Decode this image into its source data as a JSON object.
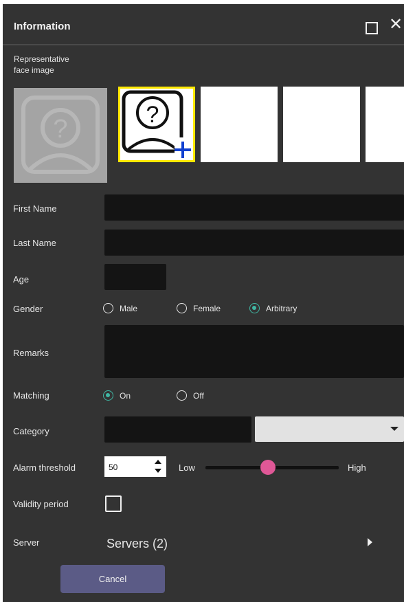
{
  "window": {
    "title": "Information"
  },
  "face": {
    "section_label_line1": "Representative",
    "section_label_line2": "face image",
    "thumbs": [
      {
        "icon": "add-face-icon",
        "selected": true
      },
      {
        "icon": "",
        "selected": false
      },
      {
        "icon": "",
        "selected": false
      },
      {
        "icon": "",
        "selected": false
      }
    ],
    "placeholder_icon": "face-placeholder-icon",
    "selected_color": "#ffe900"
  },
  "form": {
    "first_name_label": "First Name",
    "first_name_value": "",
    "last_name_label": "Last Name",
    "last_name_value": "",
    "age_label": "Age",
    "age_value": "",
    "gender_label": "Gender",
    "gender_options": [
      "Male",
      "Female",
      "Arbitrary"
    ],
    "gender_selected": "Arbitrary",
    "remarks_label": "Remarks",
    "remarks_value": "",
    "matching_label": "Matching",
    "matching_options": [
      "On",
      "Off"
    ],
    "matching_selected": "On",
    "category_label": "Category",
    "category_value": "",
    "category_select_value": "",
    "alarm_label": "Alarm threshold",
    "alarm_value": "50",
    "alarm_low": "Low",
    "alarm_high": "High",
    "alarm_slider_fraction": 0.47,
    "validity_label": "Validity period",
    "validity_checked": false,
    "server_label": "Server",
    "server_value": "Servers (2)"
  },
  "actions": {
    "cancel_label": "Cancel"
  },
  "colors": {
    "panel": "#333333",
    "radio_on": "#3fb7a4",
    "slider_thumb": "#e05897",
    "cancel_bg": "#5b5b86"
  }
}
